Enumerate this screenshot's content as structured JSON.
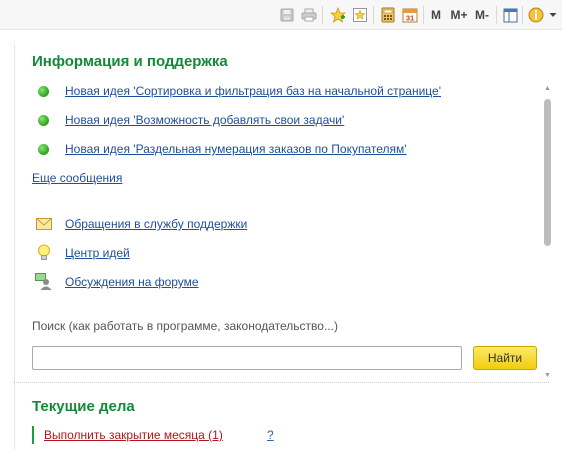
{
  "toolbar": {
    "memory_labels": [
      "M",
      "M+",
      "M-"
    ],
    "buttons": [
      {
        "name": "save-icon"
      },
      {
        "name": "print-icon"
      },
      {
        "name": "add-favorite-icon"
      },
      {
        "name": "favorites-icon"
      },
      {
        "name": "calculator-icon"
      },
      {
        "name": "calendar-icon"
      },
      {
        "name": "layout-icon"
      },
      {
        "name": "info-icon"
      }
    ],
    "calendar_day": "31"
  },
  "info_section": {
    "title": "Информация и поддержка",
    "news": [
      {
        "label": "Новая идея 'Сортировка и фильтрация баз на начальной странице'"
      },
      {
        "label": "Новая идея 'Возможность добавлять свои задачи'"
      },
      {
        "label": "Новая идея 'Раздельная нумерация заказов по Покупателям'"
      }
    ],
    "more_messages": "Еще сообщения",
    "support_links": [
      {
        "label": "Обращения в службу поддержки",
        "icon": "envelope-icon"
      },
      {
        "label": "Центр идей",
        "icon": "lightbulb-icon"
      },
      {
        "label": "Обсуждения на форуме",
        "icon": "forum-users-icon"
      }
    ],
    "search": {
      "label": "Поиск (как работать в программе, законодательство...)",
      "value": "",
      "placeholder": "",
      "button_label": "Найти"
    }
  },
  "tasks_section": {
    "title": "Текущие дела",
    "items": [
      {
        "label": "Выполнить закрытие месяца (1)",
        "help": "?"
      }
    ]
  },
  "colors": {
    "section_title": "#138a39",
    "link": "#1f4e9a",
    "task_link": "#b0161b",
    "find_button": "#f2cd0d"
  }
}
